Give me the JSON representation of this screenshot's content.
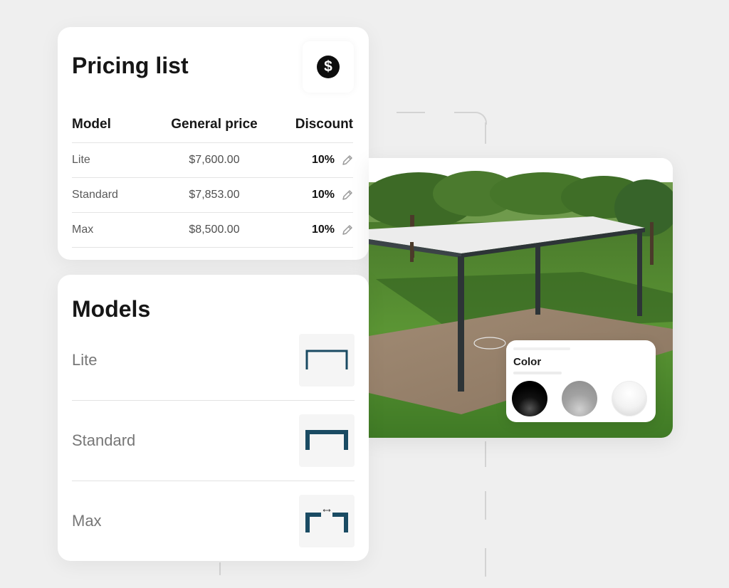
{
  "pricing": {
    "title": "Pricing list",
    "icon": "dollar-icon",
    "icon_glyph": "$",
    "columns": [
      "Model",
      "General price",
      "Discount"
    ],
    "rows": [
      {
        "model": "Lite",
        "price": "$7,600.00",
        "discount": "10%"
      },
      {
        "model": "Standard",
        "price": "$7,853.00",
        "discount": "10%"
      },
      {
        "model": "Max",
        "price": "$8,500.00",
        "discount": "10%"
      }
    ]
  },
  "models": {
    "title": "Models",
    "items": [
      {
        "name": "Lite",
        "icon": "frame-lite-icon"
      },
      {
        "name": "Standard",
        "icon": "frame-standard-icon"
      },
      {
        "name": "Max",
        "icon": "frame-max-icon"
      }
    ]
  },
  "configurator": {
    "color_label": "Color",
    "swatches": [
      {
        "name": "black",
        "hex": "#000000"
      },
      {
        "name": "gray",
        "hex": "#a2a2a2"
      },
      {
        "name": "white",
        "hex": "#f2f2f2"
      }
    ]
  },
  "colors": {
    "accent": "#1a4b63",
    "text": "#161616"
  }
}
